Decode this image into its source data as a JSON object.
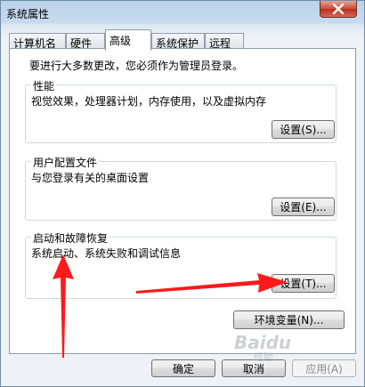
{
  "window": {
    "title": "系统属性",
    "close_icon": "close-icon"
  },
  "tabs": [
    {
      "label": "计算机名",
      "active": false
    },
    {
      "label": "硬件",
      "active": false
    },
    {
      "label": "高级",
      "active": true
    },
    {
      "label": "系统保护",
      "active": false
    },
    {
      "label": "远程",
      "active": false
    }
  ],
  "intro": "要进行大多数更改，您必须作为管理员登录。",
  "groups": {
    "performance": {
      "title": "性能",
      "description": "视觉效果，处理器计划，内存使用，以及虚拟内存",
      "button": "设置(S)..."
    },
    "user_profiles": {
      "title": "用户配置文件",
      "description": "与您登录有关的桌面设置",
      "button": "设置(E)..."
    },
    "startup_recovery": {
      "title": "启动和故障恢复",
      "description": "系统启动、系统失败和调试信息",
      "button": "设置(T)..."
    }
  },
  "env_button": "环境变量(N)...",
  "footer": {
    "ok": "确定",
    "cancel": "取消",
    "apply": "应用(A)"
  },
  "watermark": {
    "brand": "Baidu",
    "sub": "经验"
  },
  "annotation_color": "#ff1a1a"
}
